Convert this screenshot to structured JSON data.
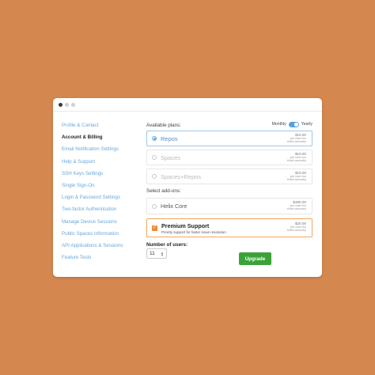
{
  "sidebar": {
    "items": [
      {
        "label": "Profile & Contact",
        "active": false
      },
      {
        "label": "Account & Billing",
        "active": true
      },
      {
        "label": "Email Notification Settings",
        "active": false
      },
      {
        "label": "Help & Support",
        "active": false
      },
      {
        "label": "SSH Keys Settings",
        "active": false
      },
      {
        "label": "Single Sign-On",
        "active": false
      },
      {
        "label": "Login & Password Settings",
        "active": false
      },
      {
        "label": "Two-factor Authentication",
        "active": false
      },
      {
        "label": "Manage Device Sessions",
        "active": false
      },
      {
        "label": "Public Spaces Information",
        "active": false
      },
      {
        "label": "API Applications & Sessions",
        "active": false
      },
      {
        "label": "Feature Tests",
        "active": false
      }
    ]
  },
  "plans": {
    "label": "Available plans:",
    "billing_toggle": {
      "left": "Monthly",
      "right": "Yearly",
      "value": "Yearly"
    },
    "items": [
      {
        "name": "Repos",
        "selected": true,
        "price": "$10.00",
        "price_note1": "per user/mo",
        "price_note2": "billed annually"
      },
      {
        "name": "Spaces",
        "selected": false,
        "price": "$10.00",
        "price_note1": "per user/mo",
        "price_note2": "billed annually"
      },
      {
        "name": "Spaces+Repos",
        "selected": false,
        "price": "$10.00",
        "price_note1": "per user/mo",
        "price_note2": "billed annually"
      }
    ]
  },
  "addons": {
    "label": "Select add-ons:",
    "items": [
      {
        "name": "Helix Core",
        "checked": false,
        "desc": "",
        "price": "$480.00",
        "price_note1": "per user/mo",
        "price_note2": "billed annually"
      },
      {
        "name": "Premium Support",
        "checked": true,
        "desc": "Priority support for faster issue resolution",
        "price": "$20.00",
        "price_note1": "per user/mo",
        "price_note2": "billed annually"
      }
    ]
  },
  "users": {
    "label": "Number of users:",
    "value": "11"
  },
  "upgrade_label": "Upgrade",
  "colors": {
    "background": "#d4874f",
    "accent": "#6aa7d8",
    "addon_checked": "#ef8a33",
    "upgrade": "#3aa338"
  }
}
